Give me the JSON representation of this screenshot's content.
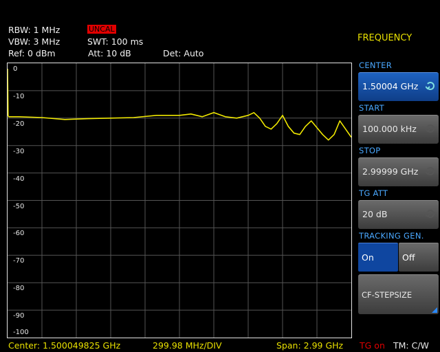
{
  "header": {
    "rbw": "RBW: 1 MHz",
    "vbw": "VBW: 3 MHz",
    "ref": "Ref: 0 dBm",
    "uncal": "UNCAL",
    "swt": "SWT: 100 ms",
    "att": "Att: 10 dB",
    "det": "Det: Auto"
  },
  "plot": {
    "y_labels": [
      "0",
      "-10",
      "-20",
      "-30",
      "-40",
      "-50",
      "-60",
      "-70",
      "-80",
      "-90",
      "-100"
    ],
    "trace_color": "#f0e800",
    "grid_color": "#555555"
  },
  "footer": {
    "center": "Center: 1.500049825 GHz",
    "div": "299.98 MHz/DIV",
    "span": "Span: 2.99 GHz",
    "tg": "TG on",
    "tm": "TM: C/W"
  },
  "menu": {
    "title": "FREQUENCY",
    "center_label": "CENTER",
    "center_value": "1.50004 GHz",
    "start_label": "START",
    "start_value": "100.000 kHz",
    "stop_label": "STOP",
    "stop_value": "2.99999 GHz",
    "tg_att_label": "TG ATT",
    "tg_att_value": "20 dB",
    "tracking_label": "TRACKING GEN.",
    "tracking_on": "On",
    "tracking_off": "Off",
    "stepsize_label": "CF-STEPSIZE"
  },
  "chart_data": {
    "type": "line",
    "xlabel": "",
    "ylabel": "",
    "xlim": [
      0.0001,
      2.99999
    ],
    "ylim": [
      -100,
      0
    ],
    "x_unit": "GHz",
    "y_unit": "dBm",
    "grid": true,
    "series": [
      {
        "x": [
          0.0001,
          0.005,
          0.01,
          0.1,
          0.3,
          0.5,
          0.7,
          0.9,
          1.1,
          1.3,
          1.5,
          1.6,
          1.7,
          1.8,
          1.9,
          2.0,
          2.1,
          2.15,
          2.2,
          2.25,
          2.3,
          2.35,
          2.4,
          2.45,
          2.5,
          2.55,
          2.6,
          2.65,
          2.7,
          2.75,
          2.8,
          2.85,
          2.9,
          2.95,
          2.99999
        ],
        "y": [
          -2,
          -19,
          -19.5,
          -19.5,
          -19.8,
          -20.5,
          -20.2,
          -20,
          -19.8,
          -19,
          -19,
          -18.5,
          -19.5,
          -18,
          -19.5,
          -20,
          -19,
          -18,
          -20,
          -23,
          -24,
          -22,
          -19,
          -23,
          -25.5,
          -26,
          -23,
          -21,
          -23.5,
          -26,
          -28,
          -26,
          -21,
          -24,
          -27
        ]
      }
    ]
  }
}
